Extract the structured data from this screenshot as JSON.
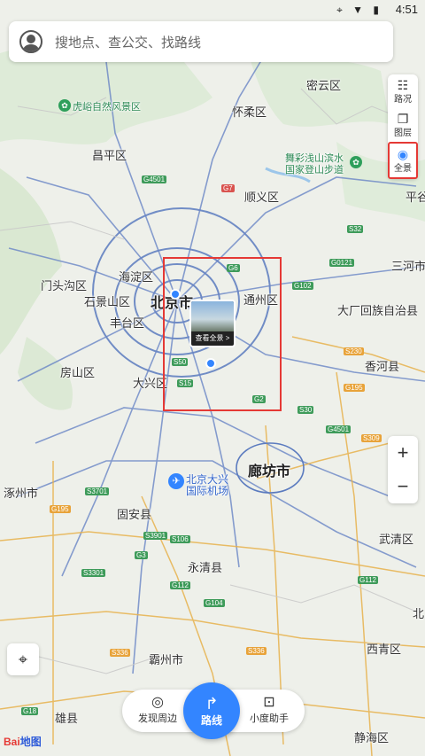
{
  "status_bar": {
    "time": "4:51"
  },
  "search": {
    "placeholder": "搜地点、查公交、找路线"
  },
  "side_panel": {
    "traffic": "路况",
    "layers": "图层",
    "panorama": "全景"
  },
  "panorama_preview": {
    "label": "查看全景 >"
  },
  "zoom": {
    "in": "+",
    "out": "−"
  },
  "bottom_nav": {
    "discover": "发现周边",
    "route": "路线",
    "assistant": "小度助手"
  },
  "logo": {
    "text_red": "Bai",
    "text_blue": "地图"
  },
  "map_labels": {
    "miyun": "密云区",
    "hulu": "虎峪自然风景区",
    "huairou": "怀柔区",
    "changping": "昌平区",
    "wucai": "舞彩浅山滨水",
    "wucai2": "国家登山步道",
    "shunyi": "顺义区",
    "pinggu": "平谷",
    "mentougou": "门头沟区",
    "haidian": "海淀区",
    "shijingshan": "石景山区",
    "beijing": "北京市",
    "tongzhou": "通州区",
    "sanhe": "三河市",
    "dachang": "大厂回族自治县",
    "fengtai": "丰台区",
    "fangshan": "房山区",
    "daxing": "大兴区",
    "xianghe": "香河县",
    "langfang": "廊坊市",
    "zhuozhou": "涿州市",
    "airport": "北京大兴",
    "airport2": "国际机场",
    "guan": "固安县",
    "wuqing": "武清区",
    "yongqing": "永清县",
    "bazhou": "霸州市",
    "xiqing": "西青区",
    "xiong": "雄县",
    "jinghai": "静海区",
    "bei": "北"
  },
  "road_badges": [
    "S3701",
    "G4501",
    "G7",
    "S32",
    "G0121",
    "G6",
    "S50",
    "G102",
    "G101",
    "G2",
    "S15",
    "S30",
    "G4501",
    "G103",
    "S309",
    "S230",
    "G195",
    "S3801",
    "S3901",
    "S106",
    "G3",
    "G112",
    "S3601",
    "S3301",
    "G104",
    "G112",
    "S336",
    "G18"
  ]
}
